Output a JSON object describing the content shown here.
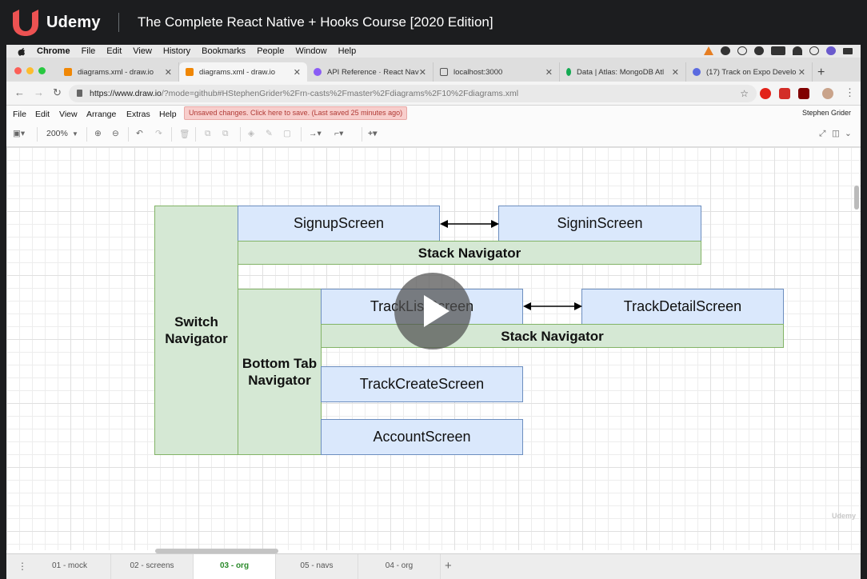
{
  "udemy": {
    "brand": "Udemy",
    "course_title": "The Complete React Native + Hooks Course [2020 Edition]",
    "watermark": "Udemy"
  },
  "mac_menu": {
    "app": "Chrome",
    "items": [
      "File",
      "Edit",
      "View",
      "History",
      "Bookmarks",
      "People",
      "Window",
      "Help"
    ]
  },
  "browser": {
    "tabs": [
      {
        "title": "diagrams.xml - draw.io",
        "icon": "drawio-icon",
        "active": false
      },
      {
        "title": "diagrams.xml - draw.io",
        "icon": "drawio-icon",
        "active": true
      },
      {
        "title": "API Reference · React Nav",
        "icon": "react-navigation-icon",
        "active": false
      },
      {
        "title": "localhost:3000",
        "icon": "page-icon",
        "active": false
      },
      {
        "title": "Data | Atlas: MongoDB Atl",
        "icon": "mongodb-leaf-icon",
        "active": false
      },
      {
        "title": "(17) Track on Expo Develo",
        "icon": "expo-icon",
        "active": false
      }
    ],
    "url_host": "https://www.draw.io",
    "url_rest": "/?mode=github#HStephenGrider%2Frn-casts%2Fmaster%2Fdiagrams%2F10%2Fdiagrams.xml"
  },
  "drawio": {
    "menu": [
      "File",
      "Edit",
      "View",
      "Arrange",
      "Extras",
      "Help"
    ],
    "unsaved_notice": "Unsaved changes. Click here to save. (Last saved 25 minutes ago)",
    "user": "Stephen Grider",
    "zoom": "200%",
    "page_tabs": [
      {
        "label": "01 - mock",
        "active": false
      },
      {
        "label": "02 - screens",
        "active": false
      },
      {
        "label": "03 - org",
        "active": true
      },
      {
        "label": "05 - navs",
        "active": false
      },
      {
        "label": "04 - org",
        "active": false
      }
    ]
  },
  "diagram": {
    "switch_nav": "Switch\nNavigator",
    "signup": "SignupScreen",
    "signin": "SigninScreen",
    "stack_nav_top": "Stack Navigator",
    "bottom_tab": "Bottom Tab\nNavigator",
    "track_list": "TrackListScreen",
    "track_detail": "TrackDetailScreen",
    "stack_nav_mid": "Stack Navigator",
    "track_create": "TrackCreateScreen",
    "account": "AccountScreen",
    "colors": {
      "green_fill": "#d5e8d4",
      "green_stroke": "#82b366",
      "blue_fill": "#dae8fc",
      "blue_stroke": "#6c8ebf"
    }
  }
}
